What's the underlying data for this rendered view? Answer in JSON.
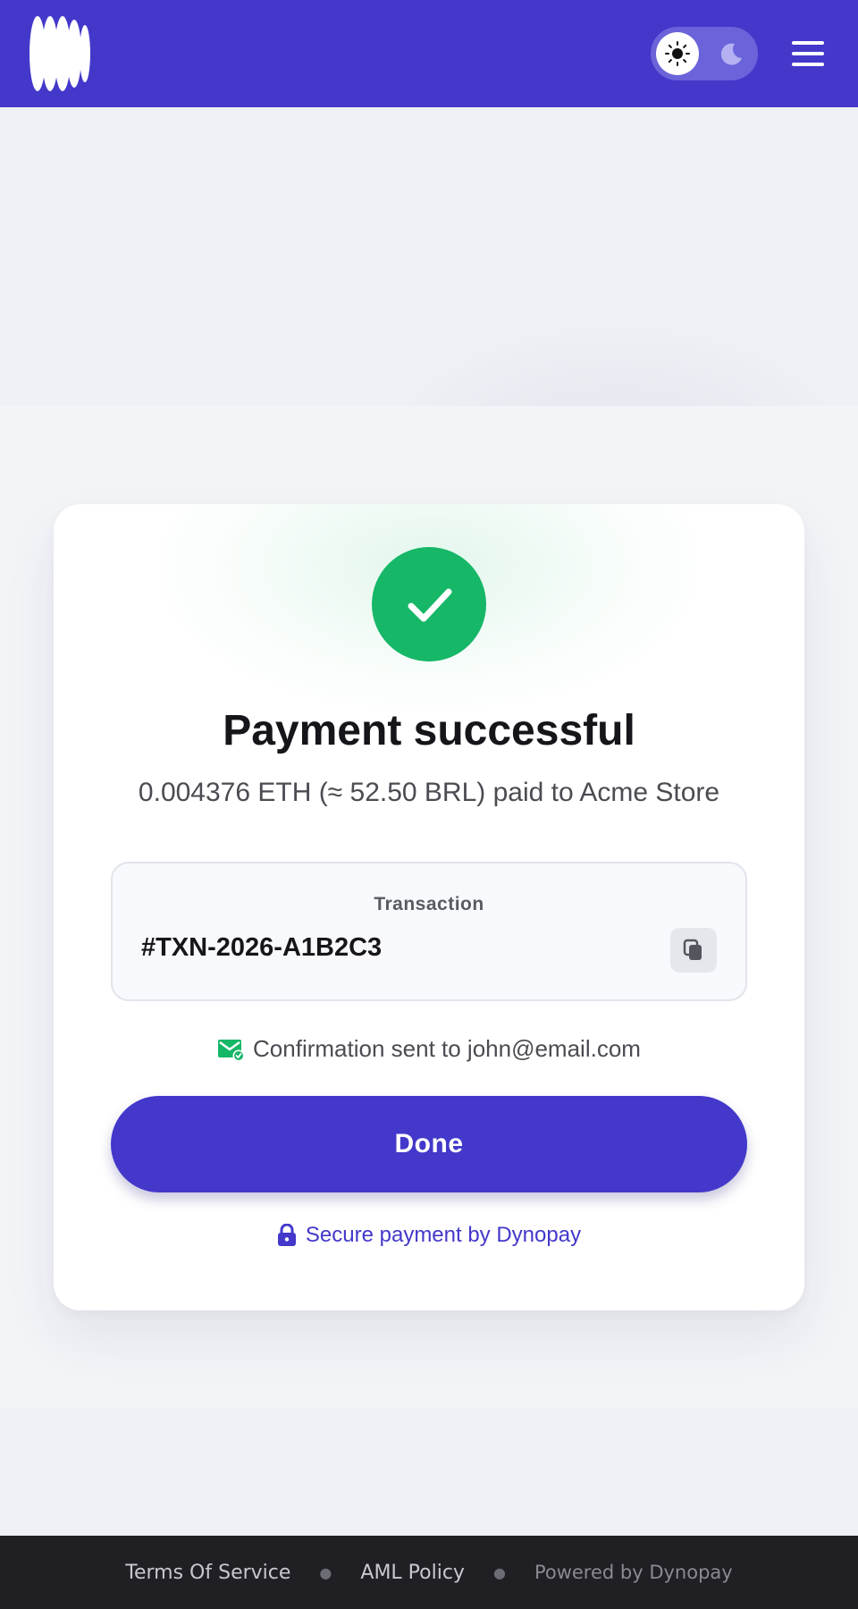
{
  "header": {
    "logo_icon": "brand-logo-icon",
    "theme_toggle": {
      "light_icon": "sun-icon",
      "dark_icon": "moon-icon",
      "active": "light"
    },
    "menu_icon": "hamburger-menu-icon"
  },
  "payment": {
    "title": "Payment successful",
    "summary": "0.004376 ETH (≈ 52.50 BRL) paid to Acme Store",
    "status_icon": "check-icon",
    "status_color": "#16b767"
  },
  "transaction": {
    "label": "Transaction",
    "id": "#TXN-2026-A1B2C3",
    "copy_icon": "copy-icon"
  },
  "confirmation": {
    "icon": "mail-check-icon",
    "text": "Confirmation sent to john@email.com"
  },
  "actions": {
    "done_label": "Done"
  },
  "security": {
    "icon": "lock-icon",
    "text": "Secure payment by Dynopay"
  },
  "footer": {
    "terms_label": "Terms Of Service",
    "aml_label": "AML Policy",
    "powered_by": "Powered by Dynopay"
  },
  "colors": {
    "brand": "#4338ca",
    "success": "#16b767",
    "footer_bg": "#1f1f24"
  }
}
